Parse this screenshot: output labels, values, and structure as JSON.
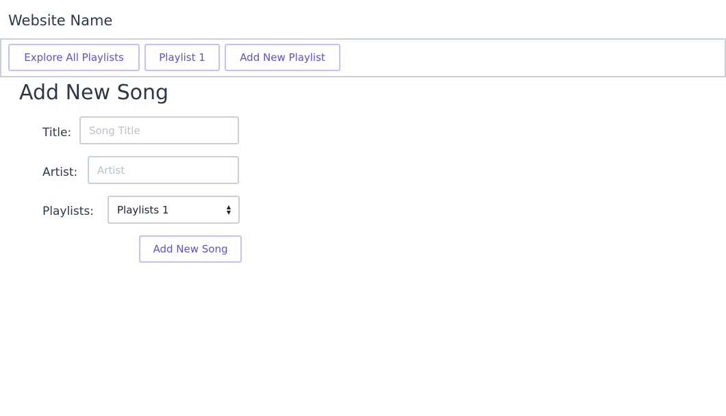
{
  "site_name": "Website Name",
  "nav": {
    "items": [
      "Explore All Playlists",
      "Playlist 1",
      "Add New Playlist"
    ]
  },
  "form": {
    "heading": "Add New Song",
    "title_label": "Title:",
    "title_placeholder": "Song Title",
    "artist_label": "Artist:",
    "artist_placeholder": "Artist",
    "playlists_label": "Playlists:",
    "playlists_selected": "Playlists 1",
    "submit_label": "Add New Song"
  },
  "colors": {
    "accent": "#5a4fe0",
    "button_border": "#c4c0fb",
    "border": "#c8d0db"
  }
}
